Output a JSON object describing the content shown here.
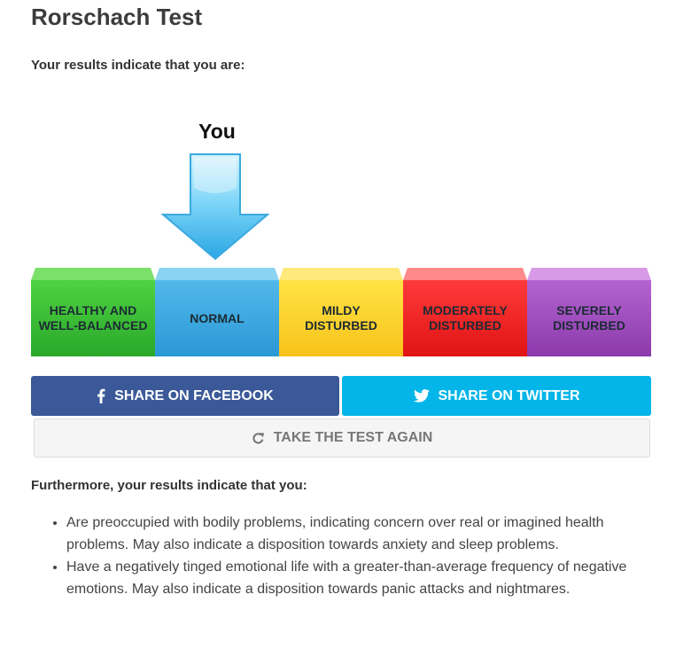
{
  "page": {
    "title": "Rorschach Test",
    "subtitle": "Your results indicate that you are:"
  },
  "indicator": {
    "label": "You",
    "selected_index": 1,
    "icon": "down-arrow-icon",
    "color": "#4cc0ee"
  },
  "scale": [
    {
      "label": "HEALTHY AND\nWELL-BALANCED",
      "color": "#3cc236"
    },
    {
      "label": "NORMAL",
      "color": "#3fabe2"
    },
    {
      "label": "MILDY\nDISTURBED",
      "color": "#fcd32e"
    },
    {
      "label": "MODERATELY\nDISTURBED",
      "color": "#f52626"
    },
    {
      "label": "SEVERELY\nDISTURBED",
      "color": "#a451c2"
    }
  ],
  "buttons": {
    "facebook": {
      "label": "SHARE ON FACEBOOK",
      "icon": "facebook-icon",
      "color": "#3b5998"
    },
    "twitter": {
      "label": "SHARE ON TWITTER",
      "icon": "twitter-icon",
      "color": "#03b5e8"
    },
    "again": {
      "label": "TAKE THE TEST AGAIN",
      "icon": "refresh-icon"
    }
  },
  "details": {
    "heading": "Furthermore, your results indicate that you:",
    "items": [
      "Are preoccupied with bodily problems, indicating concern over real or imagined health problems. May also indicate a disposition towards anxiety and sleep problems.",
      "Have a negatively tinged emotional life with a greater-than-average frequency of negative emotions. May also indicate a disposition towards panic attacks and nightmares."
    ]
  }
}
